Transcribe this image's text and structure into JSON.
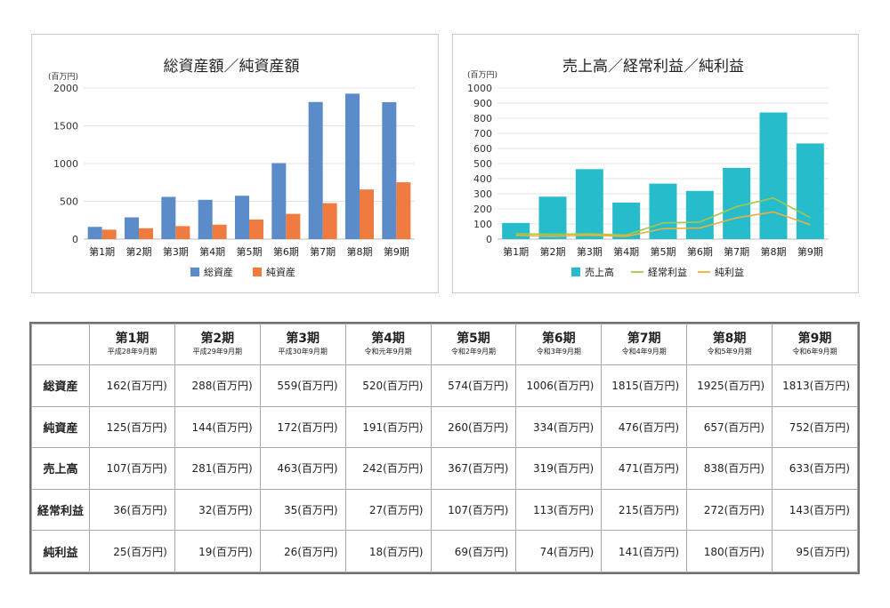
{
  "chart_data": [
    {
      "type": "bar",
      "title": "総資産額／純資産額",
      "unit_label": "(百万円)",
      "categories": [
        "第1期",
        "第2期",
        "第3期",
        "第4期",
        "第5期",
        "第6期",
        "第7期",
        "第8期",
        "第9期"
      ],
      "series": [
        {
          "name": "総資産",
          "values": [
            162,
            288,
            559,
            520,
            574,
            1006,
            1815,
            1925,
            1813
          ],
          "color": "#5b8bc9"
        },
        {
          "name": "純資産",
          "values": [
            125,
            144,
            172,
            191,
            260,
            334,
            476,
            657,
            752
          ],
          "color": "#f07b3f"
        }
      ],
      "ylim": [
        0,
        2000
      ],
      "yticks": [
        0,
        500,
        1000,
        1500,
        2000
      ],
      "grid": true,
      "legend": "bottom"
    },
    {
      "type": "bar+line",
      "title": "売上高／経常利益／純利益",
      "unit_label": "(百万円)",
      "categories": [
        "第1期",
        "第2期",
        "第3期",
        "第4期",
        "第5期",
        "第6期",
        "第7期",
        "第8期",
        "第9期"
      ],
      "series": [
        {
          "name": "売上高",
          "kind": "bar",
          "values": [
            107,
            281,
            463,
            242,
            367,
            319,
            471,
            838,
            633
          ],
          "color": "#27bccb"
        },
        {
          "name": "経常利益",
          "kind": "line",
          "values": [
            36,
            32,
            35,
            27,
            107,
            113,
            215,
            272,
            143
          ],
          "color": "#a5c84a"
        },
        {
          "name": "純利益",
          "kind": "line",
          "values": [
            25,
            19,
            26,
            18,
            69,
            74,
            141,
            180,
            95
          ],
          "color": "#f0b03a"
        }
      ],
      "ylim": [
        0,
        1000
      ],
      "yticks": [
        0,
        100,
        200,
        300,
        400,
        500,
        600,
        700,
        800,
        900,
        1000
      ],
      "grid": true,
      "legend": "bottom"
    }
  ],
  "table": {
    "columns": [
      {
        "label": "第1期",
        "sub": "平成28年9月期"
      },
      {
        "label": "第2期",
        "sub": "平成29年9月期"
      },
      {
        "label": "第3期",
        "sub": "平成30年9月期"
      },
      {
        "label": "第4期",
        "sub": "令和元年9月期"
      },
      {
        "label": "第5期",
        "sub": "令和2年9月期"
      },
      {
        "label": "第6期",
        "sub": "令和3年9月期"
      },
      {
        "label": "第7期",
        "sub": "令和4年9月期"
      },
      {
        "label": "第8期",
        "sub": "令和5年9月期"
      },
      {
        "label": "第9期",
        "sub": "令和6年9月期"
      }
    ],
    "rows": [
      {
        "label": "総資産",
        "cells": [
          "162(百万円)",
          "288(百万円)",
          "559(百万円)",
          "520(百万円)",
          "574(百万円)",
          "1006(百万円)",
          "1815(百万円)",
          "1925(百万円)",
          "1813(百万円)"
        ]
      },
      {
        "label": "純資産",
        "cells": [
          "125(百万円)",
          "144(百万円)",
          "172(百万円)",
          "191(百万円)",
          "260(百万円)",
          "334(百万円)",
          "476(百万円)",
          "657(百万円)",
          "752(百万円)"
        ]
      },
      {
        "label": "売上高",
        "cells": [
          "107(百万円)",
          "281(百万円)",
          "463(百万円)",
          "242(百万円)",
          "367(百万円)",
          "319(百万円)",
          "471(百万円)",
          "838(百万円)",
          "633(百万円)"
        ]
      },
      {
        "label": "経常利益",
        "cells": [
          "36(百万円)",
          "32(百万円)",
          "35(百万円)",
          "27(百万円)",
          "107(百万円)",
          "113(百万円)",
          "215(百万円)",
          "272(百万円)",
          "143(百万円)"
        ]
      },
      {
        "label": "純利益",
        "cells": [
          "25(百万円)",
          "19(百万円)",
          "26(百万円)",
          "18(百万円)",
          "69(百万円)",
          "74(百万円)",
          "141(百万円)",
          "180(百万円)",
          "95(百万円)"
        ]
      }
    ]
  }
}
